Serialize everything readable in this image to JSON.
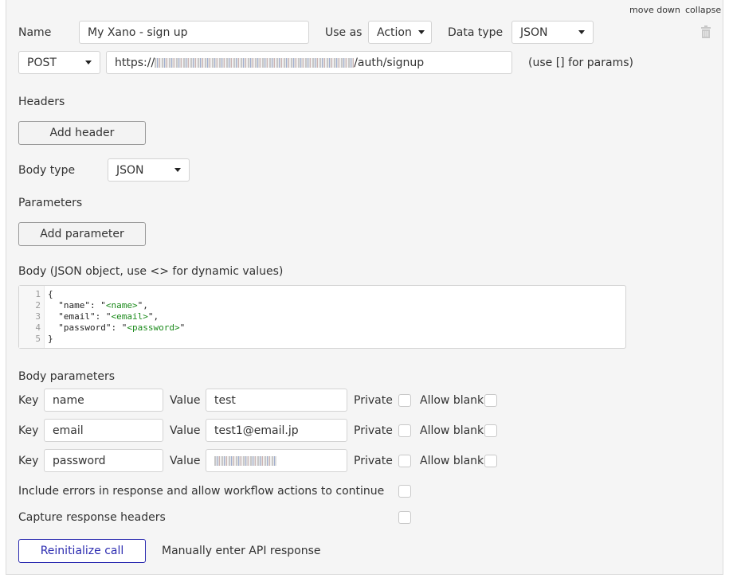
{
  "top_links": {
    "move_down": "move down",
    "collapse": "collapse"
  },
  "row1": {
    "name_label": "Name",
    "name_value": "My Xano - sign up",
    "use_as_label": "Use as",
    "use_as_value": "Action",
    "data_type_label": "Data type",
    "data_type_value": "JSON"
  },
  "row2": {
    "method_value": "POST",
    "url_prefix": "https://",
    "url_suffix": "/auth/signup",
    "url_hint": "(use [] for params)"
  },
  "headers": {
    "title": "Headers",
    "add_button": "Add header"
  },
  "body_type": {
    "label": "Body type",
    "value": "JSON"
  },
  "parameters": {
    "title": "Parameters",
    "add_button": "Add parameter"
  },
  "body": {
    "label": "Body (JSON object, use <> for dynamic values)",
    "line_numbers": [
      "1",
      "2",
      "3",
      "4",
      "5"
    ],
    "lines": [
      {
        "pre": "{",
        "dyn": "",
        "post": ""
      },
      {
        "pre": "  \"name\": \"",
        "dyn": "<name>",
        "post": "\","
      },
      {
        "pre": "  \"email\": \"",
        "dyn": "<email>",
        "post": "\","
      },
      {
        "pre": "  \"password\": \"",
        "dyn": "<password>",
        "post": "\""
      },
      {
        "pre": "}",
        "dyn": "",
        "post": ""
      }
    ]
  },
  "body_parameters": {
    "title": "Body parameters",
    "key_label": "Key",
    "value_label": "Value",
    "private_label": "Private",
    "allow_blank_label": "Allow blank",
    "rows": [
      {
        "key": "name",
        "value": "test"
      },
      {
        "key": "email",
        "value": "test1@email.jp"
      },
      {
        "key": "password",
        "value": ""
      }
    ]
  },
  "options": {
    "include_errors": "Include errors in response and allow workflow actions to continue",
    "capture_headers": "Capture response headers"
  },
  "footer": {
    "reinitialize": "Reinitialize call",
    "manual": "Manually enter API response"
  }
}
